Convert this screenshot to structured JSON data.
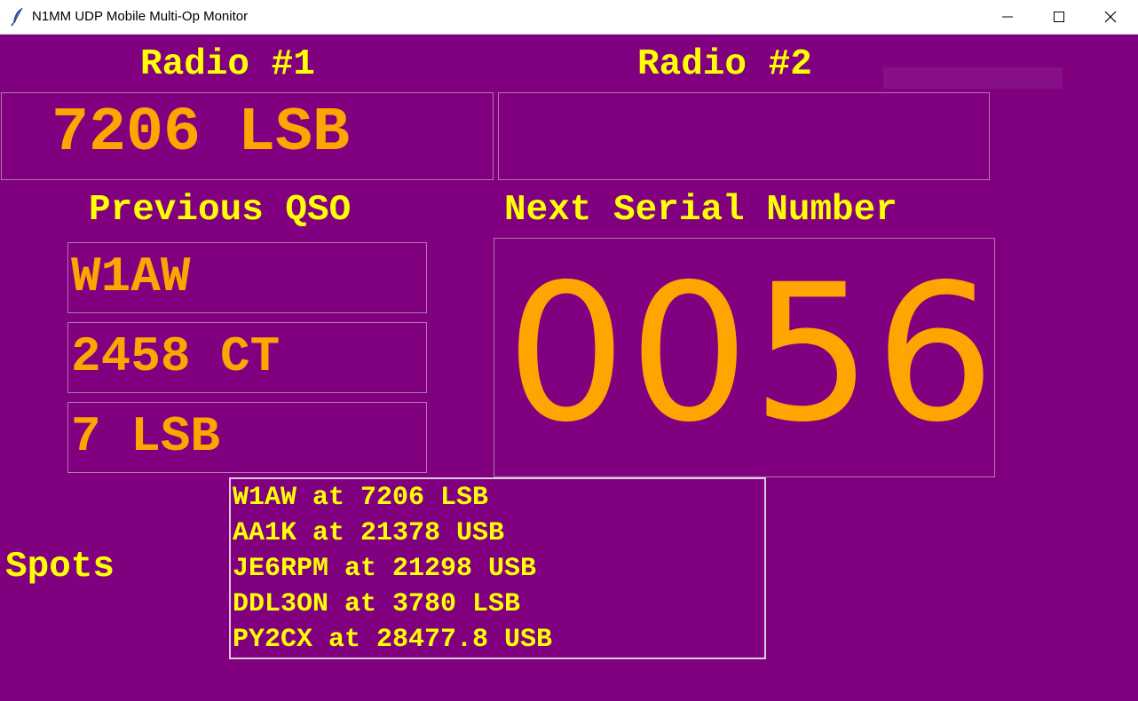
{
  "window": {
    "title": "N1MM UDP Mobile Multi-Op Monitor",
    "icon": "feather-icon",
    "buttons": [
      "minimize-icon",
      "maximize-icon",
      "close-icon"
    ]
  },
  "colors": {
    "background": "#800080",
    "label": "#ffff00",
    "value": "#ffa500",
    "box_border": "#b07ab0"
  },
  "radio1": {
    "label": "Radio #1",
    "frequency": "7206 LSB"
  },
  "radio2": {
    "label": "Radio #2",
    "frequency": ""
  },
  "previous_qso": {
    "label": "Previous QSO",
    "call": "W1AW",
    "exchange": "2458 CT",
    "band_mode": "7 LSB"
  },
  "next_serial": {
    "label": "Next Serial Number",
    "value": "0056"
  },
  "spots": {
    "label": "Spots",
    "items": [
      "W1AW at 7206 LSB",
      "AA1K at 21378 USB",
      "JE6RPM at 21298 USB",
      "DDL3ON at 3780 LSB",
      "PY2CX at 28477.8 USB"
    ]
  }
}
